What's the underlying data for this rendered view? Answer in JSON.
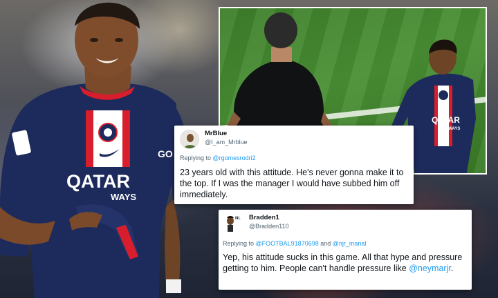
{
  "photo": {
    "jersey_sponsor_line1": "QATAR",
    "jersey_sponsor_line2": "AIRWAYS",
    "jersey_sponsor_partial": "WAYS",
    "colors": {
      "kit_navy": "#1d2a5c",
      "kit_red": "#d81e2c",
      "pitch_green": "#44882f"
    }
  },
  "tweets": [
    {
      "display_name": "MrBlue",
      "handle": "@I_am_Mrblue",
      "reply_prefix": "Replying to ",
      "reply_to": "@rgomesrodri2",
      "reply_join": "",
      "reply_to_2": "",
      "text": "23 years old with this attitude. He's never gonna make it to the top. If I was the manager I would have subbed him off immediately.",
      "text_mention": ""
    },
    {
      "display_name": "Bradden1",
      "handle": "@Bradden110",
      "reply_prefix": "Replying to ",
      "reply_to": "@FOOTBAL91870698",
      "reply_join": " and ",
      "reply_to_2": "@njr_manal",
      "text": "Yep, his attitude sucks in this game. All that hype and pressure getting to him. People can't handle pressure like ",
      "text_mention": "@neymarjr",
      "text_end": ".",
      "avatar_tag": "Ni."
    }
  ]
}
